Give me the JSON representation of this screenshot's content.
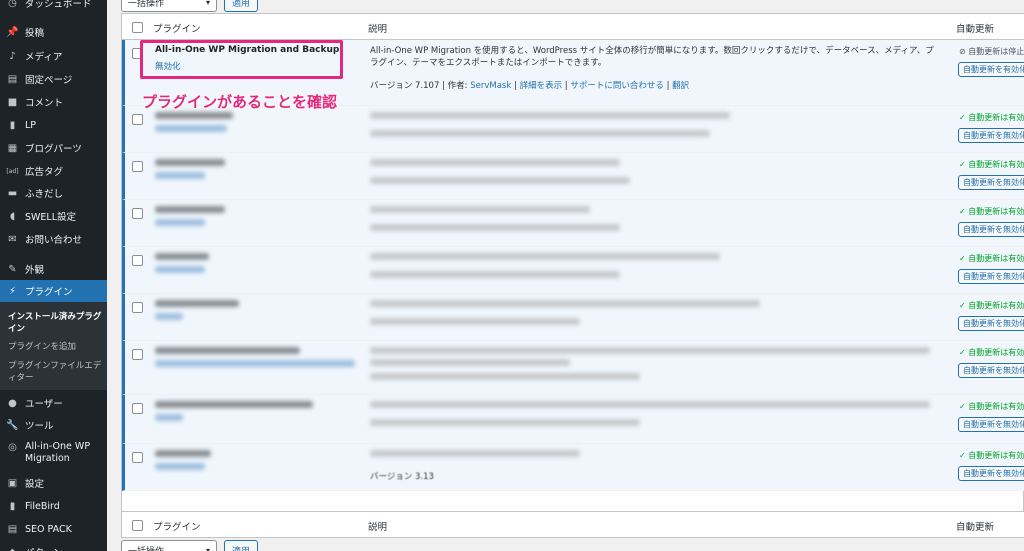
{
  "sidebar": {
    "dashboard": "ダッシュボード",
    "items": [
      {
        "label": "投稿",
        "icon": "pushpin-icon",
        "glyph": "📌"
      },
      {
        "label": "メディア",
        "icon": "media-icon",
        "glyph": "♪"
      },
      {
        "label": "固定ページ",
        "icon": "pages-icon",
        "glyph": "▤"
      },
      {
        "label": "コメント",
        "icon": "comment-icon",
        "glyph": "■"
      },
      {
        "label": "LP",
        "icon": "lp-icon",
        "glyph": "▮"
      },
      {
        "label": "ブログパーツ",
        "icon": "blogparts-icon",
        "glyph": "▦"
      },
      {
        "label": "広告タグ",
        "icon": "ad-icon",
        "glyph": "[ad]"
      },
      {
        "label": "ふきだし",
        "icon": "balloon-icon",
        "glyph": "▬"
      },
      {
        "label": "SWELL設定",
        "icon": "swell-icon",
        "glyph": "◖"
      },
      {
        "label": "お問い合わせ",
        "icon": "mail-icon",
        "glyph": "✉"
      },
      {
        "label": "外観",
        "icon": "appearance-icon",
        "glyph": "✎"
      },
      {
        "label": "プラグイン",
        "icon": "plugin-icon",
        "glyph": "⚡"
      }
    ],
    "submenu": [
      "インストール済みプラグイン",
      "プラグインを追加",
      "プラグインファイルエディター"
    ],
    "items_after": [
      {
        "label": "ユーザー",
        "icon": "user-icon",
        "glyph": "●"
      },
      {
        "label": "ツール",
        "icon": "tools-icon",
        "glyph": "🔧"
      },
      {
        "label": "All-in-One WP Migration",
        "icon": "migration-icon",
        "glyph": "◎"
      },
      {
        "label": "設定",
        "icon": "settings-icon",
        "glyph": "▣"
      },
      {
        "label": "FileBird",
        "icon": "filebird-icon",
        "glyph": "▮"
      },
      {
        "label": "SEO PACK",
        "icon": "seopack-icon",
        "glyph": "▤"
      },
      {
        "label": "パターン",
        "icon": "pattern-icon",
        "glyph": "◆"
      }
    ]
  },
  "bulk": {
    "select_label": "一括操作",
    "apply_label": "適用"
  },
  "table": {
    "col_plugin": "プラグイン",
    "col_description": "説明",
    "col_auto_update": "自動更新"
  },
  "plugin": {
    "name": "All-in-One WP Migration and Backup",
    "action": "無効化",
    "description": "All-in-One WP Migration を使用すると、WordPress サイト全体の移行が簡単になります。数回クリックするだけで、データベース、メディア、プラグイン、テーマをエクスポートまたはインポートできます。",
    "version": "バージョン 7.107",
    "author_label": "作者:",
    "author": "ServMask",
    "details": "詳細を表示",
    "support": "サポートに問い合わせる",
    "translate": "翻訳",
    "auto_status": "自動更新は停止中",
    "auto_button": "自動更新を有効化"
  },
  "other_rows": {
    "auto_status": "自動更新は有効中",
    "auto_button": "自動更新を無効化"
  },
  "last_row_meta": "バージョン 3.13",
  "annotation": "プラグインがあることを確認"
}
